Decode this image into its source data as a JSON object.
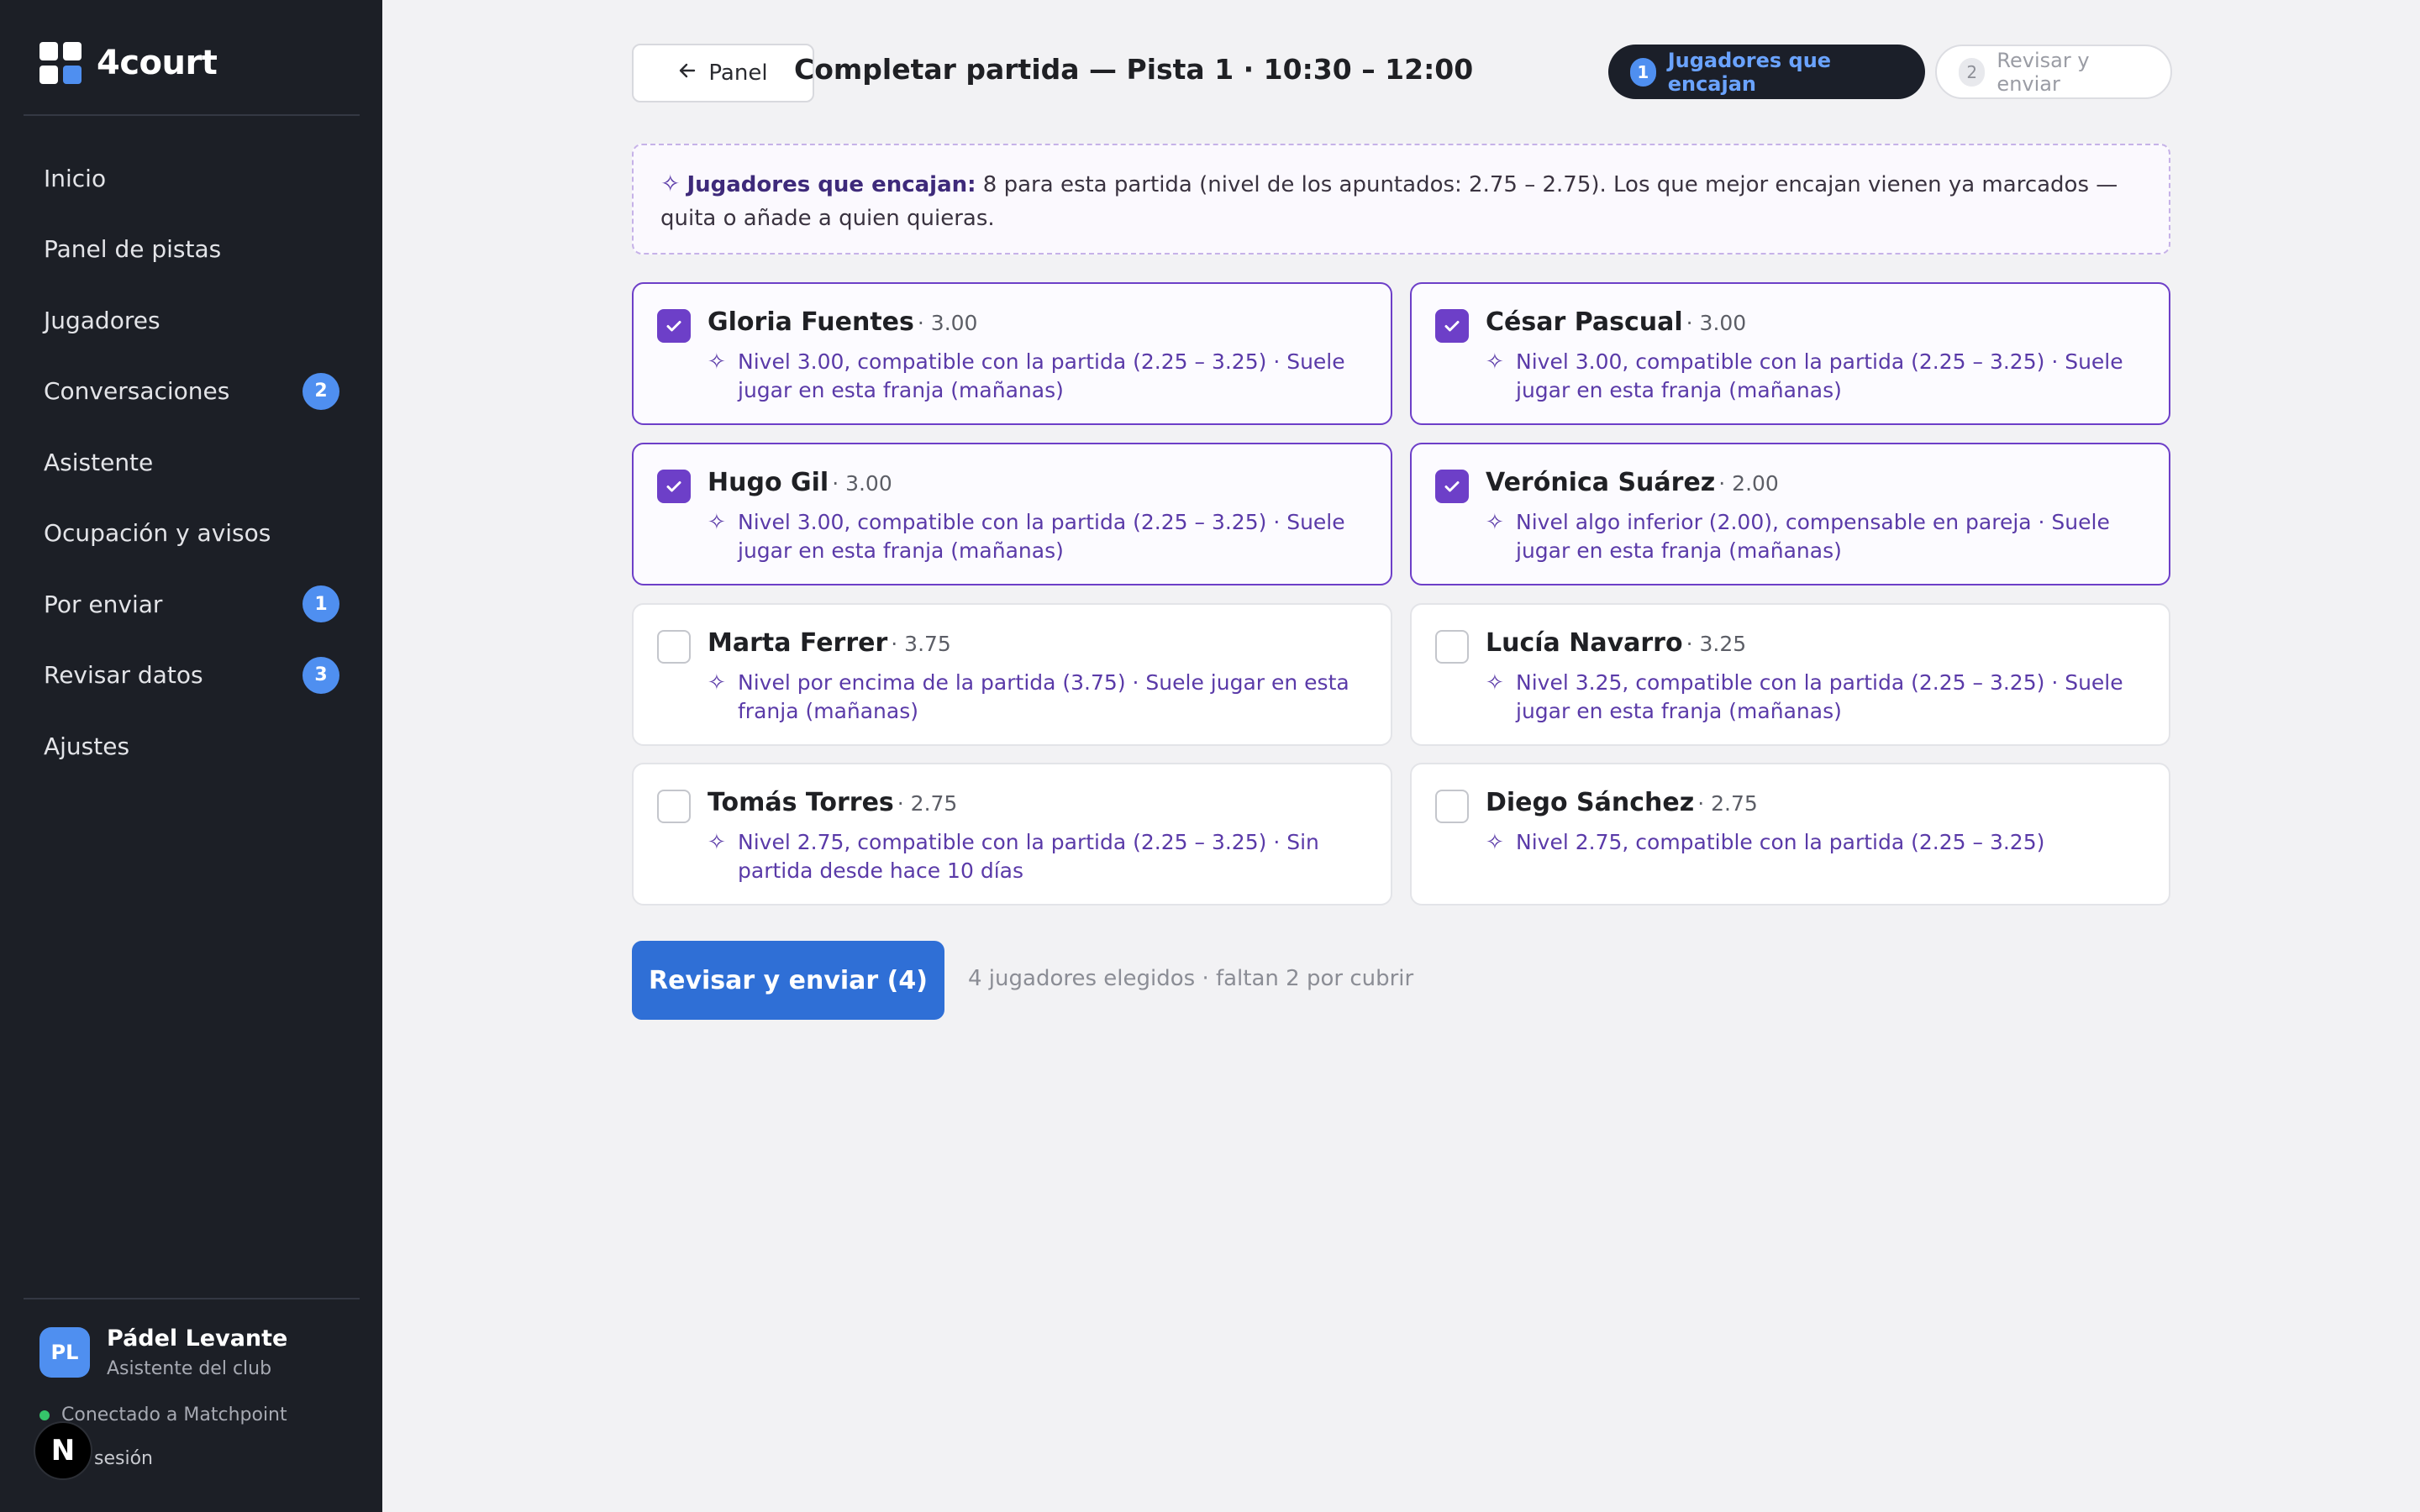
{
  "app": {
    "name": "4court"
  },
  "sidebar": {
    "items": [
      {
        "label": "Inicio",
        "badge": null
      },
      {
        "label": "Panel de pistas",
        "badge": null
      },
      {
        "label": "Jugadores",
        "badge": null
      },
      {
        "label": "Conversaciones",
        "badge": "2"
      },
      {
        "label": "Asistente",
        "badge": null
      },
      {
        "label": "Ocupación y avisos",
        "badge": null
      },
      {
        "label": "Por enviar",
        "badge": "1"
      },
      {
        "label": "Revisar datos",
        "badge": "3"
      },
      {
        "label": "Ajustes",
        "badge": null
      }
    ],
    "user": {
      "initials": "PL",
      "name": "Pádel Levante",
      "role": "Asistente del club"
    },
    "connection": "Conectado a Matchpoint",
    "logout": "sesión",
    "dev_badge": "N"
  },
  "header": {
    "back_label": "Panel",
    "title": "Completar partida — Pista 1 · 10:30 – 12:00",
    "steps": [
      {
        "num": "1",
        "label": "Jugadores que encajan",
        "active": true
      },
      {
        "num": "2",
        "label": "Revisar y enviar",
        "active": false
      }
    ]
  },
  "info": {
    "strong": "Jugadores que encajan:",
    "text": " 8 para esta partida (nivel de los apuntados: 2.75 – 2.75). Los que mejor encajan vienen ya marcados — quita o añade a quien quieras."
  },
  "players": [
    {
      "name": "Gloria Fuentes",
      "level": "· 3.00",
      "reason": "Nivel 3.00, compatible con la partida (2.25 – 3.25) · Suele jugar en esta franja (mañanas)",
      "selected": true
    },
    {
      "name": "César Pascual",
      "level": "· 3.00",
      "reason": "Nivel 3.00, compatible con la partida (2.25 – 3.25) · Suele jugar en esta franja (mañanas)",
      "selected": true
    },
    {
      "name": "Hugo Gil",
      "level": "· 3.00",
      "reason": "Nivel 3.00, compatible con la partida (2.25 – 3.25) · Suele jugar en esta franja (mañanas)",
      "selected": true
    },
    {
      "name": "Verónica Suárez",
      "level": "· 2.00",
      "reason": "Nivel algo inferior (2.00), compensable en pareja · Suele jugar en esta franja (mañanas)",
      "selected": true
    },
    {
      "name": "Marta Ferrer",
      "level": "· 3.75",
      "reason": "Nivel por encima de la partida (3.75) · Suele jugar en esta franja (mañanas)",
      "selected": false
    },
    {
      "name": "Lucía Navarro",
      "level": "· 3.25",
      "reason": "Nivel 3.25, compatible con la partida (2.25 – 3.25) · Suele jugar en esta franja (mañanas)",
      "selected": false
    },
    {
      "name": "Tomás Torres",
      "level": "· 2.75",
      "reason": "Nivel 2.75, compatible con la partida (2.25 – 3.25) · Sin partida desde hace 10 días",
      "selected": false
    },
    {
      "name": "Diego Sánchez",
      "level": "· 2.75",
      "reason": "Nivel 2.75, compatible con la partida (2.25 – 3.25)",
      "selected": false
    }
  ],
  "footer": {
    "primary_label": "Revisar y enviar (4)",
    "note": "4 jugadores elegidos · faltan 2 por cubrir"
  },
  "colors": {
    "accent": "#6d3fc8",
    "primary": "#2f6fd6",
    "sidebar_bg": "#1c1f26",
    "badge": "#4f8ff0"
  },
  "icons": {
    "back": "arrow-left-icon",
    "sparkle": "sparkle-icon",
    "check": "check-icon"
  }
}
